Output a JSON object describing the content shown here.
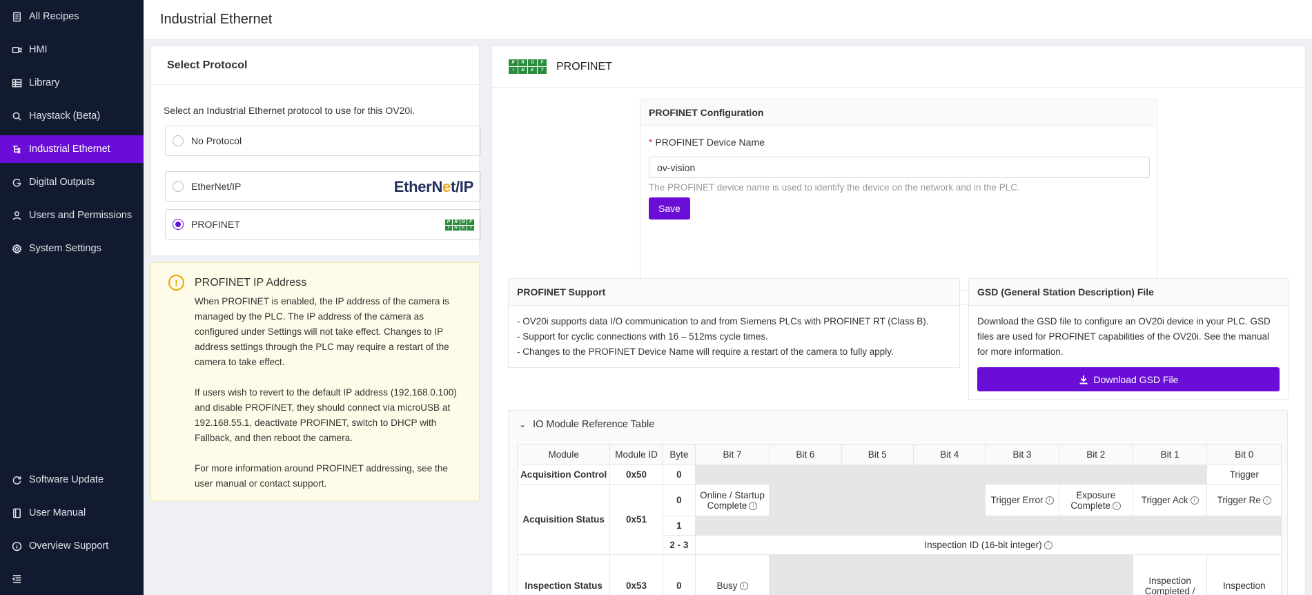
{
  "sidebar": {
    "items": [
      {
        "label": "All Recipes",
        "icon": "document-icon"
      },
      {
        "label": "HMI",
        "icon": "video-icon"
      },
      {
        "label": "Library",
        "icon": "table-icon"
      },
      {
        "label": "Haystack (Beta)",
        "icon": "search-icon"
      },
      {
        "label": "Industrial Ethernet",
        "icon": "network-icon"
      },
      {
        "label": "Digital Outputs",
        "icon": "output-icon"
      },
      {
        "label": "Users and Permissions",
        "icon": "user-icon"
      },
      {
        "label": "System Settings",
        "icon": "gear-icon"
      }
    ],
    "bottom_items": [
      {
        "label": "Software Update",
        "icon": "refresh-icon"
      },
      {
        "label": "User Manual",
        "icon": "book-icon"
      },
      {
        "label": "Overview Support",
        "icon": "info-icon"
      }
    ],
    "active_color": "#6a0dd6"
  },
  "header": {
    "title": "Industrial Ethernet"
  },
  "select_protocol": {
    "title": "Select Protocol",
    "intro": "Select an Industrial Ethernet protocol to use for this OV20i.",
    "options": [
      {
        "label": "No Protocol",
        "selected": false
      },
      {
        "label": "EtherNet/IP",
        "selected": false,
        "logo_text_a": "EtherN",
        "logo_text_b": "e",
        "logo_text_c": "t/IP"
      },
      {
        "label": "PROFINET",
        "selected": true
      }
    ]
  },
  "warning": {
    "title": "PROFINET IP Address",
    "paragraphs": [
      "When PROFINET is enabled, the IP address of the camera is managed by the PLC. The IP address of the camera as configured under Settings will not take effect. Changes to IP address settings through the PLC may require a restart of the camera to take effect.",
      "If users wish to revert to the default IP address (192.168.0.100) and disable PROFINET, they should connect via microUSB at 192.168.55.1, deactivate PROFINET, switch to DHCP with Fallback, and then reboot the camera.",
      "For more information around PROFINET addressing, see the user manual or contact support."
    ]
  },
  "profinet": {
    "title": "PROFINET",
    "logo_letters": [
      "P",
      "R",
      "O",
      "F",
      "I",
      "N",
      "E",
      "T"
    ],
    "config": {
      "title": "PROFINET Configuration",
      "required_mark": "*",
      "device_name_label": "PROFINET Device Name",
      "device_name_value": "ov-vision",
      "help": "The PROFINET device name is used to identify the device on the network and in the PLC.",
      "save_label": "Save"
    },
    "support": {
      "title": "PROFINET Support",
      "lines": [
        "- OV20i supports data I/O communication to and from Siemens PLCs with PROFINET RT (Class B).",
        "- Support for cyclic connections with 16 – 512ms cycle times.",
        "- Changes to the PROFINET Device Name will require a restart of the camera to fully apply."
      ]
    },
    "gsd": {
      "title": "GSD (General Station Description) File",
      "text": "Download the GSD file to configure an OV20i device in your PLC. GSD files are used for PROFINET capabilities of the OV20i. See the manual for more information.",
      "button_label": "Download GSD File"
    },
    "io_table": {
      "title": "IO Module Reference Table",
      "headers": [
        "Module",
        "Module ID",
        "Byte",
        "Bit 7",
        "Bit 6",
        "Bit 5",
        "Bit 4",
        "Bit 3",
        "Bit 2",
        "Bit 1",
        "Bit 0"
      ],
      "acq_control": {
        "module": "Acquisition Control",
        "id": "0x50",
        "byte": "0",
        "bit0": "Trigger"
      },
      "acq_status": {
        "module": "Acquisition Status",
        "id": "0x51",
        "byte0": "0",
        "byte1": "1",
        "byte23": "2 - 3",
        "bit7": "Online / Startup Complete",
        "bit3": "Trigger Error",
        "bit2": "Exposure Complete",
        "bit1": "Trigger Ack",
        "bit0": "Trigger Re",
        "inspection_id": "Inspection ID (16-bit integer)"
      },
      "insp_status": {
        "module": "Inspection Status",
        "id": "0x53",
        "byte": "0",
        "bit7": "Busy",
        "bit1": "Inspection Completed /",
        "bit0": "Inspection"
      }
    }
  }
}
